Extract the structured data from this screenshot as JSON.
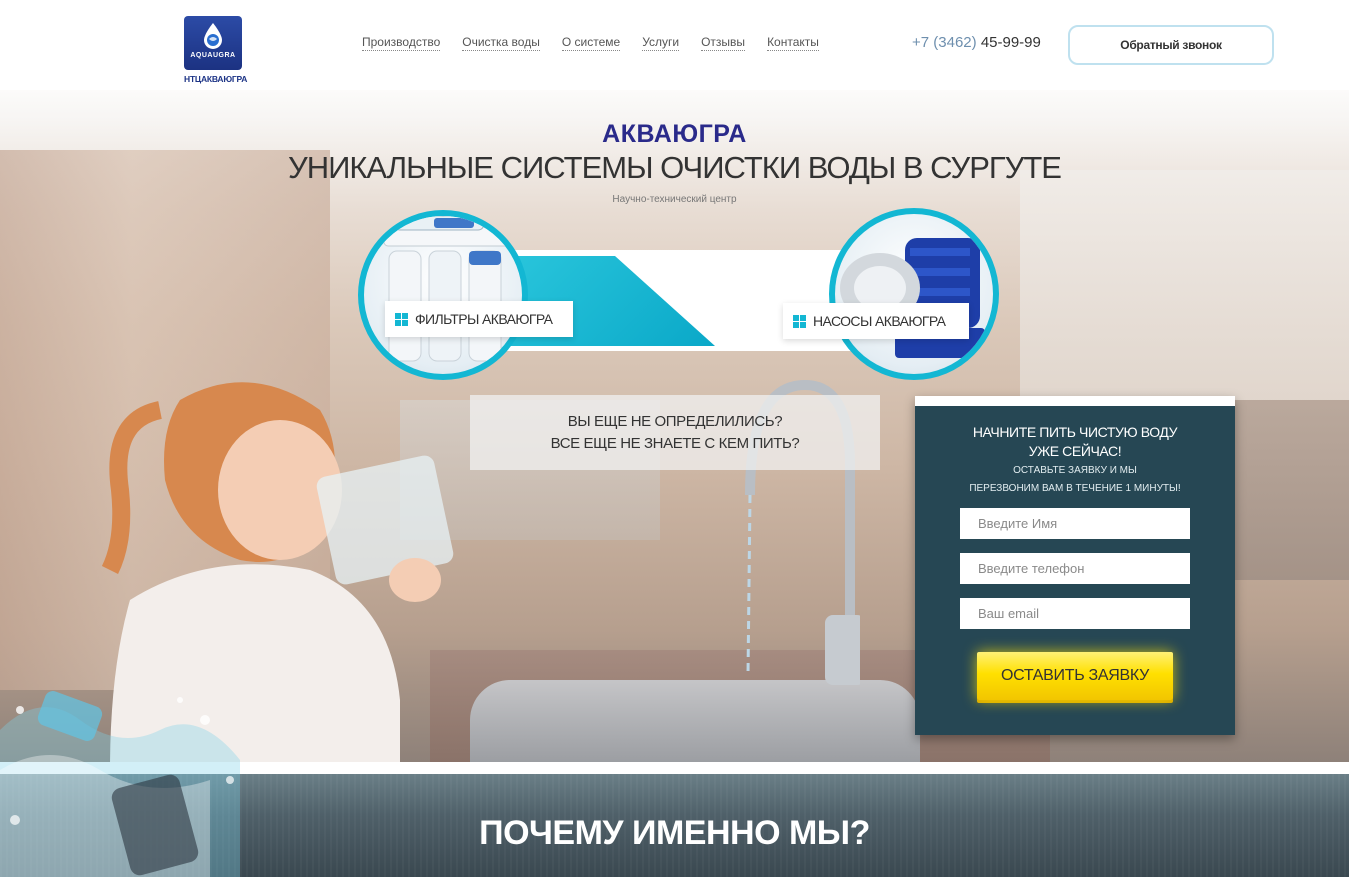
{
  "header": {
    "logo_text": "AQUAUGRA",
    "logo_sub": "НТЦАКВАЮГРА",
    "nav": [
      "Производство",
      "Очистка воды",
      "О системе",
      "Услуги",
      "Отзывы",
      "Контакты"
    ],
    "phone_code": "+7 (3462)",
    "phone_number": "45-99-99",
    "callback_label": "Обратный звонок"
  },
  "hero": {
    "brand": "АКВАЮГРА",
    "headline": "УНИКАЛЬНЫЕ СИСТЕМЫ ОЧИСТКИ ВОДЫ В СУРГУТЕ",
    "subline": "Научно-технический центр",
    "product_left": "ФИЛЬТРЫ АКВАЮГРА",
    "product_right": "НАСОСЫ АКВАЮГРА",
    "question_line1": "ВЫ ЕЩЕ НЕ ОПРЕДЕЛИЛИСЬ?",
    "question_line2": "ВСЕ ЕЩЕ НЕ ЗНАЕТЕ С КЕМ ПИТЬ?"
  },
  "form": {
    "title_line1": "НАЧНИТЕ ПИТЬ ЧИСТУЮ ВОДУ",
    "title_line2": "УЖЕ СЕЙЧАС!",
    "note_line1": "ОСТАВЬТЕ ЗАЯВКУ И МЫ",
    "note_line2": "ПЕРЕЗВОНИМ ВАМ В ТЕЧЕНИЕ 1 МИНУТЫ!",
    "name_placeholder": "Введите Имя",
    "phone_placeholder": "Введите телефон",
    "email_placeholder": "Ваш email",
    "submit_label": "ОСТАВИТЬ ЗАЯВКУ"
  },
  "why": {
    "title": "ПОЧЕМУ ИМЕННО МЫ?"
  },
  "colors": {
    "accent": "#13b7d3",
    "brand_blue": "#2a2a8a",
    "form_bg": "#264754",
    "button_yellow": "#ffe000"
  },
  "icons": [
    "water-drop-logo-icon",
    "grid-icon"
  ]
}
